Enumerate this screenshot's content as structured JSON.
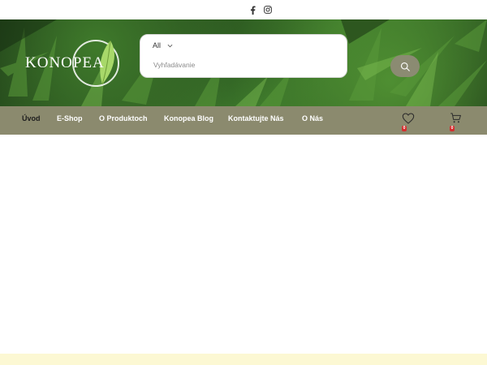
{
  "social": {
    "facebook_icon": "facebook-icon",
    "instagram_icon": "instagram-icon"
  },
  "header": {
    "logo_text": "KONOPEA",
    "search": {
      "category": "All",
      "placeholder": "Vyhľadávanie",
      "value": ""
    }
  },
  "nav": {
    "items": [
      {
        "label": "Úvod",
        "active": true
      },
      {
        "label": "E-Shop"
      },
      {
        "label": "O Produktoch"
      },
      {
        "label": "Konopea Blog"
      },
      {
        "label": "Kontaktujte Nás"
      },
      {
        "label": "O Nás"
      }
    ],
    "wishlist_count": "0",
    "cart_count": "0"
  },
  "colors": {
    "nav_bg": "#8b8a6e",
    "active_text": "#1e1e1e",
    "badge": "#d32f2f",
    "footer_strip": "#fcf8d3"
  }
}
